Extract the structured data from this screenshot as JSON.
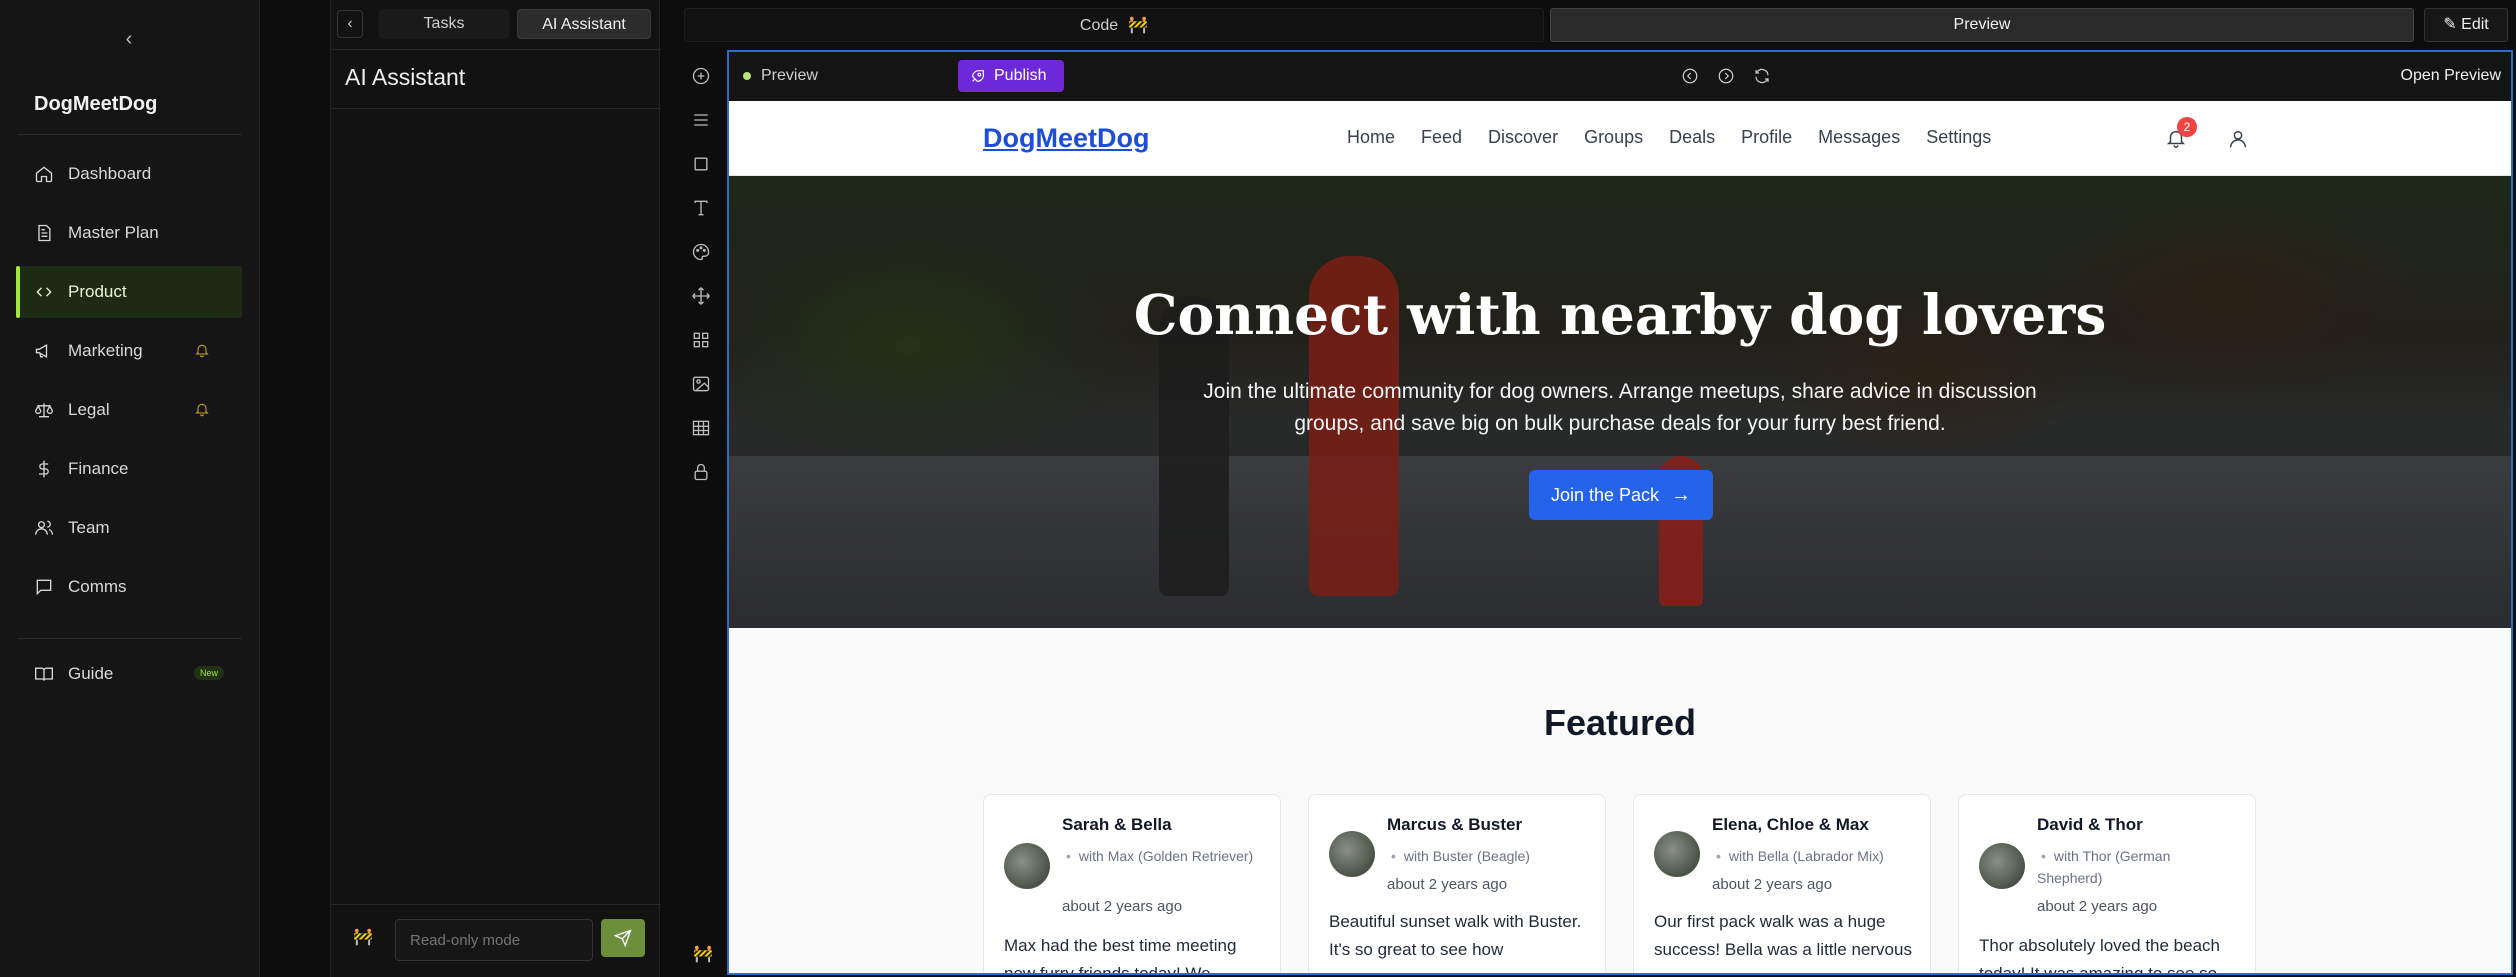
{
  "sidebar": {
    "brand": "DogMeetDog",
    "items": [
      {
        "label": "Dashboard"
      },
      {
        "label": "Master Plan"
      },
      {
        "label": "Product"
      },
      {
        "label": "Marketing"
      },
      {
        "label": "Legal"
      },
      {
        "label": "Finance"
      },
      {
        "label": "Team"
      },
      {
        "label": "Comms"
      }
    ],
    "guide": {
      "label": "Guide",
      "badge": "New"
    }
  },
  "assistant": {
    "tabs": [
      "Tasks",
      "AI Assistant"
    ],
    "title": "AI Assistant",
    "input_placeholder": "Read-only mode"
  },
  "topbar": {
    "code_label": "Code",
    "preview_label": "Preview",
    "edit_label": "Edit"
  },
  "preview_bar": {
    "label": "Preview",
    "publish_label": "Publish",
    "open_label": "Open Preview"
  },
  "site": {
    "logo": "DogMeetDog",
    "nav": [
      "Home",
      "Feed",
      "Discover",
      "Groups",
      "Deals",
      "Profile",
      "Messages",
      "Settings"
    ],
    "notification_count": "2",
    "hero": {
      "title": "Connect with nearby dog lovers",
      "subtitle": "Join the ultimate community for dog owners. Arrange meetups, share advice in discussion groups, and save big on bulk purchase deals for your furry best friend.",
      "cta": "Join the Pack"
    },
    "featured_title": "Featured",
    "cards": [
      {
        "name": "Sarah & Bella",
        "with": "with Max (Golden Retriever)",
        "time": "about 2 years ago",
        "text": "Max had the best time meeting new furry friends today! We..."
      },
      {
        "name": "Marcus & Buster",
        "with": "with Buster (Beagle)",
        "time": "about 2 years ago",
        "text": "Beautiful sunset walk with Buster. It's so great to see how"
      },
      {
        "name": "Elena, Chloe & Max",
        "with": "with Bella (Labrador Mix)",
        "time": "about 2 years ago",
        "text": "Our first pack walk was a huge success! Bella was a little nervous"
      },
      {
        "name": "David & Thor",
        "with": "with Thor (German Shepherd)",
        "time": "about 2 years ago",
        "text": "Thor absolutely loved the beach today! It was amazing to see so"
      }
    ]
  },
  "colors": {
    "accent_green": "#a3e635",
    "publish_purple": "#6d28d9",
    "cta_blue": "#2563eb",
    "logo_blue": "#1d4ed8",
    "frame_border": "#2f6ec7"
  }
}
